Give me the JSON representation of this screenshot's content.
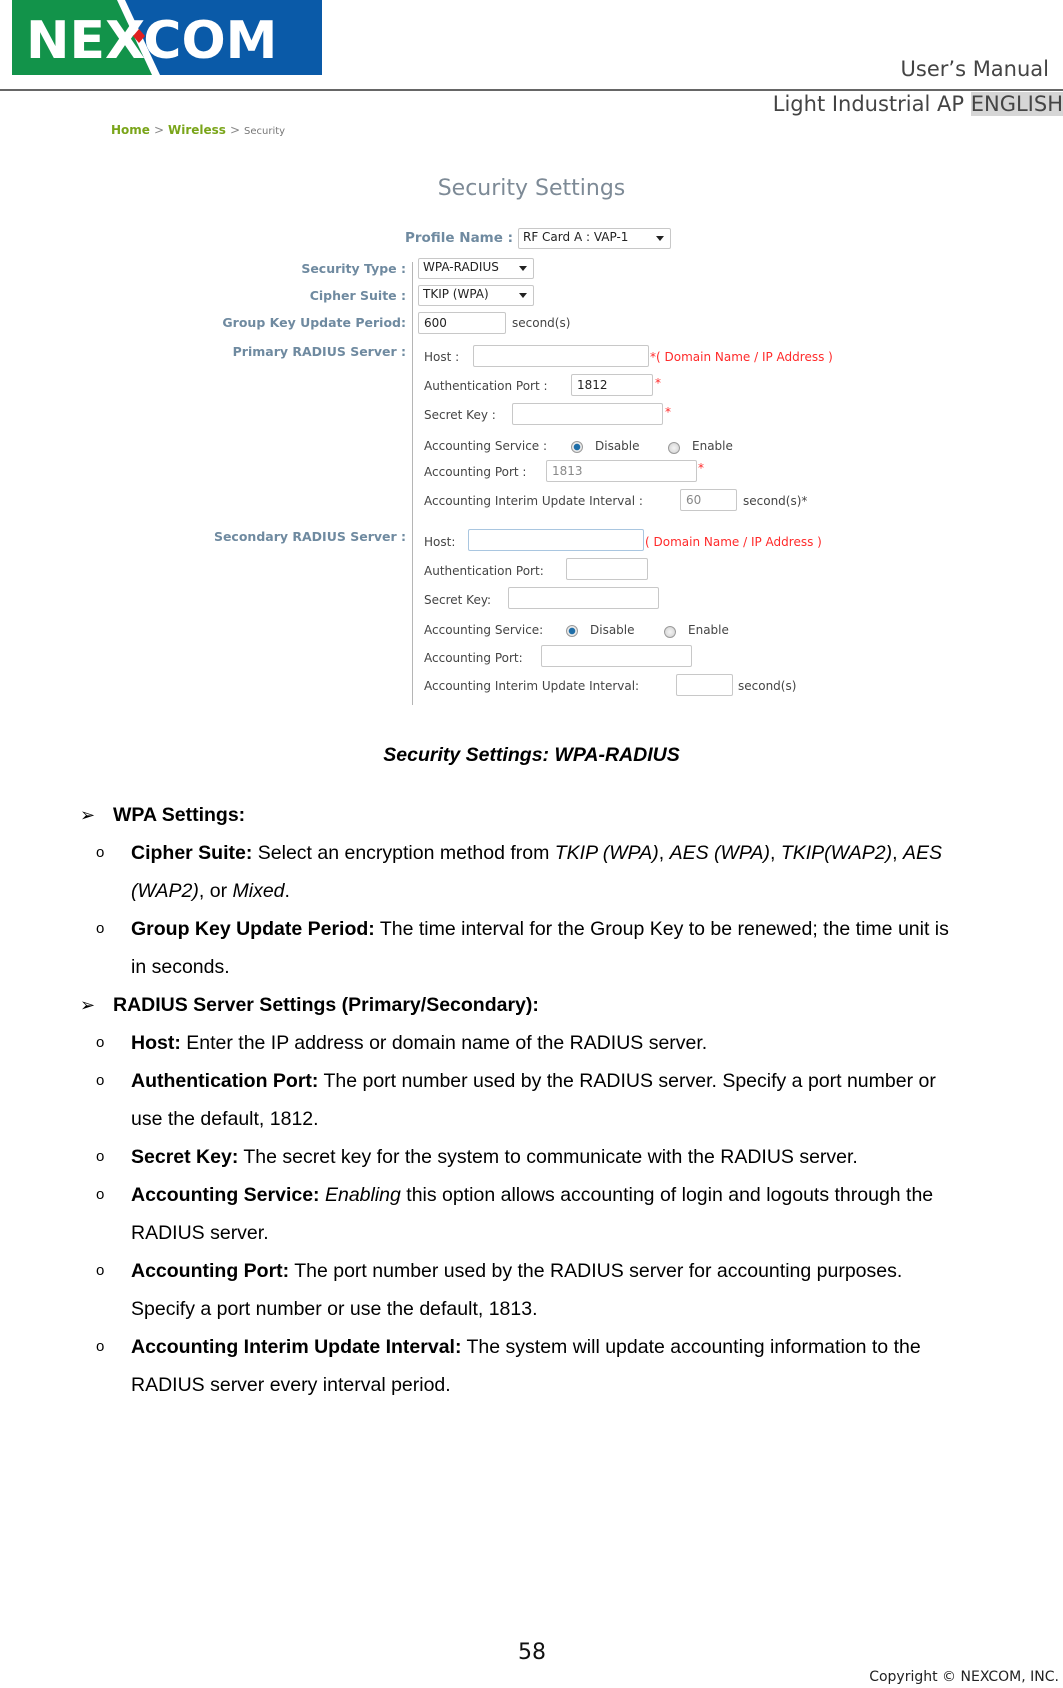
{
  "header": {
    "logo_text": "NEXCOM",
    "manual_label": "User’s Manual",
    "product_line": "Light Industrial AP",
    "language": "ENGLISH"
  },
  "breadcrumb": {
    "items": [
      "Home",
      "Wireless",
      "Security"
    ],
    "separator": ">"
  },
  "form": {
    "title": "Security Settings",
    "profile_label": "Profile Name :",
    "profile_value": "RF Card A : VAP-1",
    "security_type_label": "Security Type :",
    "security_type_value": "WPA-RADIUS",
    "cipher_label": "Cipher Suite :",
    "cipher_value": "TKIP (WPA)",
    "group_key_label": "Group Key Update Period:",
    "group_key_value": "600",
    "group_key_unit": "second(s)",
    "primary": {
      "section_label": "Primary RADIUS Server :",
      "host_label": "Host :",
      "host_value": "",
      "host_hint": "*( Domain Name / IP Address )",
      "auth_port_label": "Authentication Port :",
      "auth_port_value": "1812",
      "secret_label": "Secret Key :",
      "secret_value": "",
      "required_mark": "*",
      "acct_service_label": "Accounting Service :",
      "acct_disable": "Disable",
      "acct_enable": "Enable",
      "acct_selected": "Disable",
      "acct_port_label": "Accounting Port :",
      "acct_port_value": "1813",
      "interim_label": "Accounting Interim Update Interval :",
      "interim_value": "60",
      "interim_unit": "second(s)*"
    },
    "secondary": {
      "section_label": "Secondary RADIUS Server :",
      "host_label": "Host:",
      "host_value": "",
      "host_hint": "( Domain Name / IP Address )",
      "auth_port_label": "Authentication Port:",
      "auth_port_value": "",
      "secret_label": "Secret Key:",
      "secret_value": "",
      "acct_service_label": "Accounting Service:",
      "acct_disable": "Disable",
      "acct_enable": "Enable",
      "acct_selected": "Disable",
      "acct_port_label": "Accounting Port:",
      "acct_port_value": "",
      "interim_label": "Accounting Interim Update Interval:",
      "interim_value": "",
      "interim_unit": "second(s)"
    }
  },
  "doc": {
    "caption": "Security Settings: WPA-RADIUS",
    "section1": {
      "title": "WPA Settings:",
      "items": [
        {
          "term": "Cipher Suite:",
          "lines": [
            [
              " Select an encryption method from ",
              "TKIP (WPA)",
              ", ",
              "AES (WPA)",
              ", ",
              "TKIP(WAP2)",
              ", ",
              "AES"
            ],
            [
              "(WAP2)",
              ", or ",
              "Mixed",
              "."
            ]
          ]
        },
        {
          "term": "Group Key Update Period:",
          "line1": " The time interval for the Group Key to be renewed; the time unit is",
          "line2": "in seconds."
        }
      ]
    },
    "section2": {
      "title": "RADIUS Server Settings (Primary/Secondary):",
      "items": [
        {
          "term": "Host:",
          "line1": " Enter the IP address or domain name of the RADIUS server.",
          "line2": ""
        },
        {
          "term": "Authentication Port:",
          "line1": " The port number used by the RADIUS server. Specify a port number or",
          "line2": "use the default, 1812."
        },
        {
          "term": "Secret Key:",
          "line1": " The secret key for the system to communicate with the RADIUS server.",
          "line2": ""
        },
        {
          "term": "Accounting Service:",
          "italic": "Enabling",
          "line1": " this option allows accounting of login and logouts through the",
          "line2": "RADIUS server."
        },
        {
          "term": "Accounting Port:",
          "line1": " The port number used by the RADIUS server for accounting purposes.",
          "line2": "Specify a port number or use the default, 1813."
        },
        {
          "term": "Accounting Interim Update Interval:",
          "line1": " The system will update accounting information to the",
          "line2": "RADIUS server every interval period."
        }
      ]
    },
    "bullet_arrow": "➢",
    "bullet_circle": "o"
  },
  "footer": {
    "page_number": "58",
    "copyright": "Copyright © NEXCOM, INC."
  }
}
